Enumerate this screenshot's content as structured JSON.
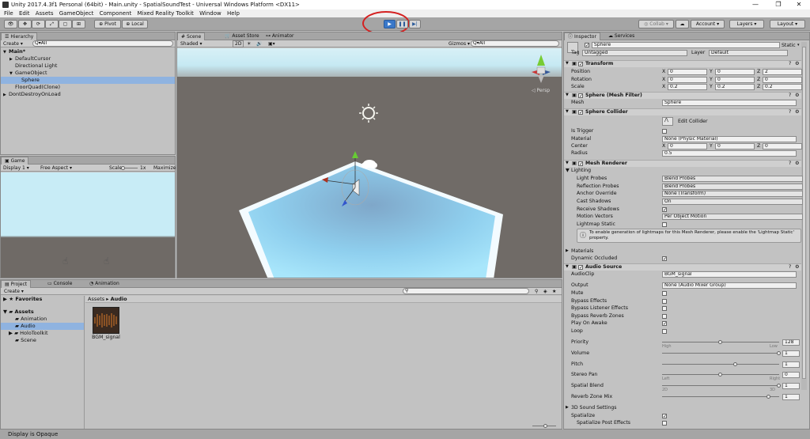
{
  "window": {
    "title": "Unity 2017.4.3f1 Personal (64bit) - Main.unity - SpatialSoundTest - Universal Windows Platform <DX11>",
    "minimize": "—",
    "maximize": "❐",
    "close": "✕"
  },
  "menu": [
    "File",
    "Edit",
    "Assets",
    "GameObject",
    "Component",
    "Mixed Reality Toolkit",
    "Window",
    "Help"
  ],
  "toolbar": {
    "pivot": "Pivot",
    "local": "Local",
    "collab": "Collab",
    "account": "Account",
    "layers": "Layers",
    "layout": "Layout"
  },
  "hierarchy": {
    "tab": "Hierarchy",
    "create": "Create",
    "search": "Q▾All",
    "rows": [
      {
        "label": "Main*",
        "indent": 0,
        "arrow": "▼",
        "selected": false,
        "bold": true
      },
      {
        "label": "DefaultCursor",
        "indent": 1,
        "arrow": "▶",
        "selected": false,
        "bold": false
      },
      {
        "label": "Directional Light",
        "indent": 1,
        "arrow": "",
        "selected": false,
        "bold": false
      },
      {
        "label": "GameObject",
        "indent": 1,
        "arrow": "▼",
        "selected": false,
        "bold": false
      },
      {
        "label": "Sphere",
        "indent": 2,
        "arrow": "",
        "selected": true,
        "bold": false
      },
      {
        "label": "FloorQuad(Clone)",
        "indent": 1,
        "arrow": "",
        "selected": false,
        "bold": false
      },
      {
        "label": "DontDestroyOnLoad",
        "indent": 0,
        "arrow": "▶",
        "selected": false,
        "bold": false
      }
    ]
  },
  "game": {
    "tab": "Game",
    "display": "Display 1",
    "aspect": "Free Aspect",
    "scale_label": "Scale",
    "scale_value": "1x",
    "maximize": "Maximize"
  },
  "scene": {
    "tabs": [
      "Scene",
      "Asset Store",
      "Animator"
    ],
    "shading": "Shaded",
    "mode2d": "2D",
    "gizmos": "Gizmos",
    "search": "Q▾All",
    "persp": "◁ Persp"
  },
  "project": {
    "tabs": [
      "Project",
      "Console",
      "Animation"
    ],
    "create": "Create",
    "favorites": "Favorites",
    "assets": "Assets",
    "folders": [
      "Animation",
      "Audio",
      "HoloToolkit",
      "Scene"
    ],
    "breadcrumb": [
      "Assets",
      "Audio"
    ],
    "asset_name": "BGM_signal"
  },
  "status": "Display is Opaque",
  "inspector": {
    "tabs": [
      "Inspector",
      "Services"
    ],
    "object_name": "Sphere",
    "static": "Static",
    "tag_label": "Tag",
    "tag": "Untagged",
    "layer_label": "Layer",
    "layer": "Default",
    "transform": {
      "title": "Transform",
      "rows": [
        {
          "label": "Position",
          "x": "0",
          "y": "0",
          "z": "2"
        },
        {
          "label": "Rotation",
          "x": "0",
          "y": "0",
          "z": "0"
        },
        {
          "label": "Scale",
          "x": "0.2",
          "y": "0.2",
          "z": "0.2"
        }
      ]
    },
    "mesh_filter": {
      "title": "Sphere (Mesh Filter)",
      "mesh_label": "Mesh",
      "mesh": "Sphere"
    },
    "sphere_collider": {
      "title": "Sphere Collider",
      "edit": "Edit Collider",
      "is_trigger": "Is Trigger",
      "material_label": "Material",
      "material": "None (Physic Material)",
      "center_label": "Center",
      "cx": "0",
      "cy": "0",
      "cz": "0",
      "radius_label": "Radius",
      "radius": "0.5"
    },
    "mesh_renderer": {
      "title": "Mesh Renderer",
      "lighting": "Lighting",
      "rows": [
        {
          "label": "Light Probes",
          "value": "Blend Probes"
        },
        {
          "label": "Reflection Probes",
          "value": "Blend Probes"
        },
        {
          "label": "Anchor Override",
          "value": "None (Transform)"
        },
        {
          "label": "Cast Shadows",
          "value": "On"
        }
      ],
      "receive_shadows": "Receive Shadows",
      "motion_vectors_label": "Motion Vectors",
      "motion_vectors": "Per Object Motion",
      "lightmap_static": "Lightmap Static",
      "info": "To enable generation of lightmaps for this Mesh Renderer, please enable the 'Lightmap Static' property.",
      "materials": "Materials",
      "dynamic_occluded": "Dynamic Occluded"
    },
    "audio_source": {
      "title": "Audio Source",
      "clip_label": "AudioClip",
      "clip": "BGM_signal",
      "output_label": "Output",
      "output": "None (Audio Mixer Group)",
      "toggles": [
        {
          "label": "Mute",
          "checked": false
        },
        {
          "label": "Bypass Effects",
          "checked": false
        },
        {
          "label": "Bypass Listener Effects",
          "checked": false
        },
        {
          "label": "Bypass Reverb Zones",
          "checked": false
        },
        {
          "label": "Play On Awake",
          "checked": true
        },
        {
          "label": "Loop",
          "checked": false
        }
      ],
      "sliders": [
        {
          "label": "Priority",
          "value": "128",
          "fraction": 0.5,
          "min_label": "High",
          "max_label": "Low"
        },
        {
          "label": "Volume",
          "value": "1",
          "fraction": 1.0,
          "min_label": "",
          "max_label": ""
        },
        {
          "label": "Pitch",
          "value": "1",
          "fraction": 0.63,
          "min_label": "",
          "max_label": ""
        },
        {
          "label": "Stereo Pan",
          "value": "0",
          "fraction": 0.5,
          "min_label": "Left",
          "max_label": "Right"
        },
        {
          "label": "Spatial Blend",
          "value": "1",
          "fraction": 1.0,
          "min_label": "2D",
          "max_label": "3D"
        },
        {
          "label": "Reverb Zone Mix",
          "value": "1",
          "fraction": 0.91,
          "min_label": "",
          "max_label": ""
        }
      ],
      "sound3d": "3D Sound Settings",
      "spatialize": "Spatialize",
      "spatialize_post": "Spatialize Post Effects"
    }
  },
  "colors": {
    "play_accent": "#3a78c9",
    "highlight_circle": "#d42020",
    "selection": "#8fb3e0",
    "floor": "#9fdcf5",
    "sky": "#bfe6f2"
  }
}
